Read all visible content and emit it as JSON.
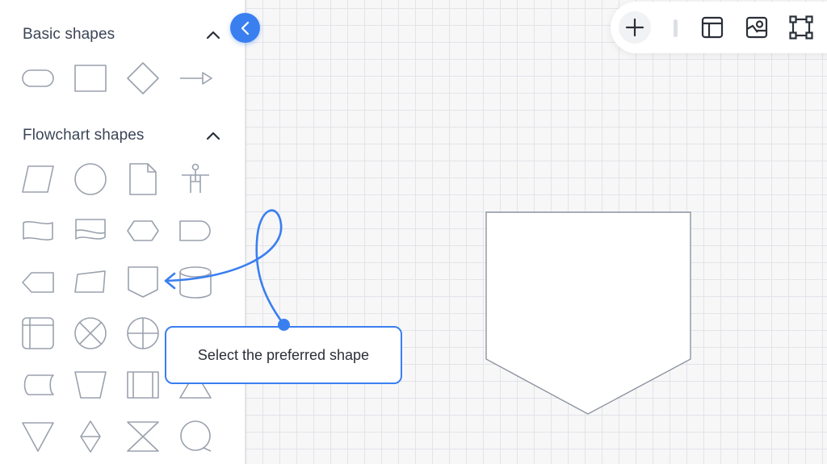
{
  "sidebar": {
    "basic_title": "Basic shapes",
    "flowchart_title": "Flowchart shapes",
    "basic_shapes": [
      "terminator",
      "rectangle",
      "diamond",
      "arrow"
    ],
    "flowchart_shapes": [
      "parallelogram",
      "circle",
      "document",
      "actor",
      "tape",
      "multi-document",
      "preparation",
      "delay",
      "display",
      "manual-input",
      "off-page-connector",
      "database",
      "internal-storage",
      "summing-junction",
      "or",
      "card",
      "stored-data",
      "manual-operation",
      "predefined-process",
      "merge",
      "extract",
      "sort",
      "collate",
      "connector"
    ]
  },
  "toolbar": {
    "buttons": [
      "add-icon",
      "layout-icon",
      "image-icon",
      "frame-icon"
    ]
  },
  "canvas": {
    "selected_shape": "off-page-connector"
  },
  "tooltip": {
    "text": "Select the preferred shape"
  },
  "colors": {
    "accent": "#3a7ff0",
    "shape_stroke": "#9aa1ad",
    "text": "#3b4557",
    "grid": "#e3e4e8"
  }
}
